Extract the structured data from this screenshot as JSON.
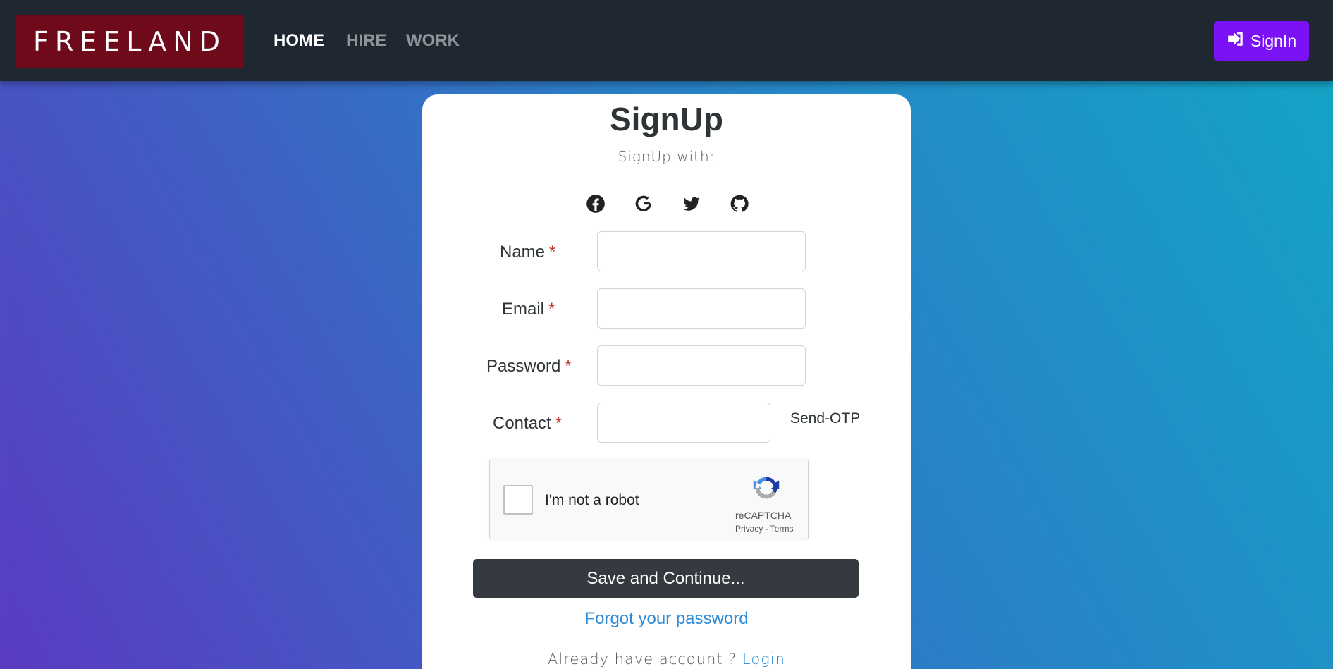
{
  "nav": {
    "brand": "FREELAND",
    "links": [
      "HOME",
      "HIRE",
      "WORK"
    ],
    "signin_label": "SignIn",
    "colors": {
      "bar": "#1f2730",
      "brand_bg": "#6e0a1a",
      "signin_bg": "#7a12f5"
    }
  },
  "form": {
    "title": "SignUp",
    "subtitle": "SignUp with:",
    "social_icons": [
      "facebook-icon",
      "google-icon",
      "twitter-icon",
      "github-icon"
    ],
    "fields": [
      {
        "label": "Name",
        "value": ""
      },
      {
        "label": "Email",
        "value": ""
      },
      {
        "label": "Password",
        "value": ""
      },
      {
        "label": "Contact",
        "value": ""
      }
    ],
    "required_mark": "*",
    "send_otp": "Send-OTP",
    "captcha": {
      "text": "I'm not a robot",
      "brand": "reCAPTCHA",
      "privacy": "Privacy",
      "separator": " - ",
      "terms": "Terms"
    },
    "save_label": "Save and Continue...",
    "forgot_label": "Forgot your password",
    "already_text": "Already have account ? ",
    "login_label": "Login"
  }
}
